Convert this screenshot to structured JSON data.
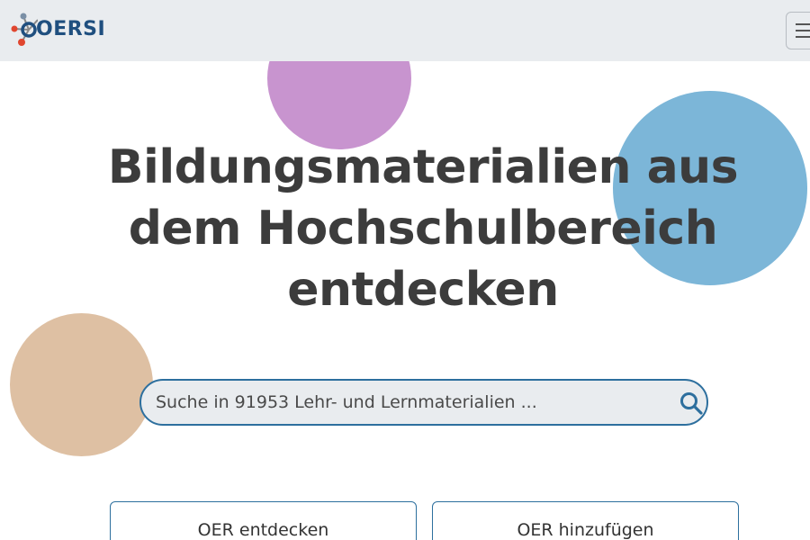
{
  "header": {
    "logo_text": "OERSI",
    "menu_icon": "hamburger-menu-icon"
  },
  "hero": {
    "title": "Bildungsmaterialien aus dem Hochschulbereich entdecken"
  },
  "search": {
    "placeholder": "Suche in 91953 Lehr- und Lernmaterialien ...",
    "value": "",
    "icon": "search-icon"
  },
  "actions": {
    "discover_label": "OER entdecken",
    "add_label": "OER hinzufügen"
  },
  "colors": {
    "header_bg": "#e9ecef",
    "accent": "#2d6f9e",
    "circle_purple": "#c894cf",
    "circle_blue": "#7cb6d8",
    "circle_tan": "#dec0a3",
    "title_text": "#3c3c3c"
  }
}
